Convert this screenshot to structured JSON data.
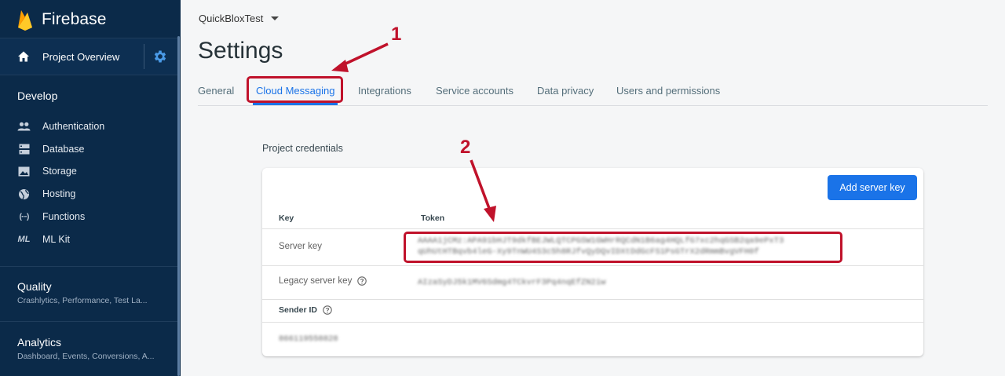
{
  "sidebar": {
    "brand": "Firebase",
    "project_overview": "Project Overview",
    "develop": {
      "title": "Develop",
      "items": [
        {
          "label": "Authentication",
          "icon": "people-icon"
        },
        {
          "label": "Database",
          "icon": "database-icon"
        },
        {
          "label": "Storage",
          "icon": "storage-icon"
        },
        {
          "label": "Hosting",
          "icon": "globe-icon"
        },
        {
          "label": "Functions",
          "icon": "functions-icon",
          "glyph": "(···)"
        },
        {
          "label": "ML Kit",
          "icon": "ml-kit-icon",
          "glyph": "ML"
        }
      ]
    },
    "quality": {
      "title": "Quality",
      "subtitle": "Crashlytics, Performance, Test La..."
    },
    "analytics": {
      "title": "Analytics",
      "subtitle": "Dashboard, Events, Conversions, A..."
    }
  },
  "header": {
    "project_name": "QuickBloxTest",
    "page_title": "Settings"
  },
  "tabs": [
    {
      "label": "General",
      "active": false
    },
    {
      "label": "Cloud Messaging",
      "active": true
    },
    {
      "label": "Integrations",
      "active": false
    },
    {
      "label": "Service accounts",
      "active": false
    },
    {
      "label": "Data privacy",
      "active": false
    },
    {
      "label": "Users and permissions",
      "active": false
    }
  ],
  "credentials": {
    "section_label": "Project credentials",
    "add_button": "Add server key",
    "columns": {
      "key": "Key",
      "token": "Token"
    },
    "server_key": {
      "label": "Server key",
      "token_line1": "AAAA1jCMz:APA91bHJT9dkfBEJWLQTCPGSW1GWHrRQCdN1B6ag4HQLfG7xc2hqGSB2qa9ePxT3",
      "token_line2": "qUhUtHTBqvb4leG-Xy9TnWU4S3c5h8RJfvQyDQvIDXtDdGcFS1PsGTrX2dRmmBvgVFH0f"
    },
    "legacy_key": {
      "label": "Legacy server key",
      "token": "AIzaSyDJ5k1MV6Sdmg4TCkvrF3Pq4nqEfZN2iw"
    },
    "sender_id": {
      "label": "Sender ID",
      "value": "866119558828"
    }
  },
  "annotations": {
    "first": "1",
    "second": "2"
  },
  "colors": {
    "accent": "#1a73e8",
    "annotation": "#c0122b",
    "sidebar": "#0b2a49"
  }
}
